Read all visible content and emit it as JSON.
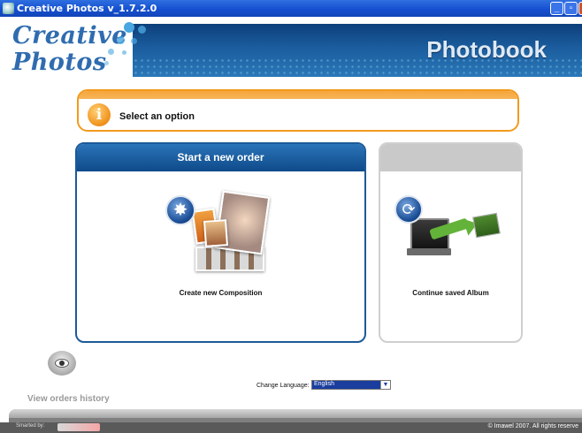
{
  "window": {
    "title": "Creative Photos v_1.7.2.0"
  },
  "header": {
    "logo_line1": "Creative",
    "logo_line2": "Photos",
    "product": "Photobook"
  },
  "prompt": {
    "text": "Select an option"
  },
  "new_order": {
    "title": "Start a new order",
    "option_label": "Create new Composition"
  },
  "saved": {
    "option_label": "Continue saved Album"
  },
  "history": {
    "label": "View orders history"
  },
  "language": {
    "label": "Change Language:",
    "selected": "English"
  },
  "footer": {
    "smarted_by": "Smarted by:",
    "copyright": "© Imawel 2007. All rights reserve"
  },
  "icons": [
    "app-icon",
    "info-icon",
    "star-icon",
    "refresh-icon",
    "eye-icon",
    "chevron-down-icon"
  ]
}
